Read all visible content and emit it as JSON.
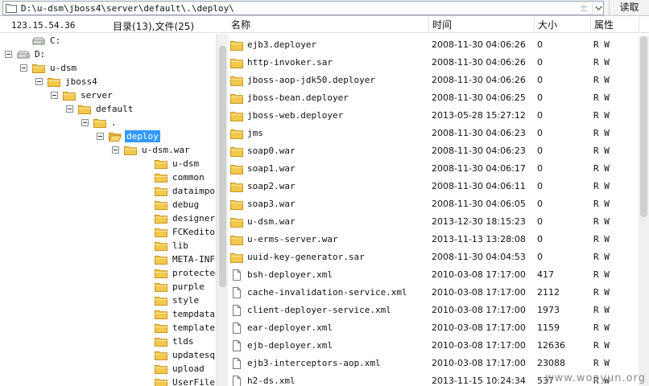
{
  "topbar": {
    "path": "D:\\u-dsm\\jboss4\\server\\default\\.\\deploy\\",
    "sort_glyph": "±",
    "read_label": "读取"
  },
  "left": {
    "server_ip": "123.15.54.36",
    "dir_count": "目录(13),文件(25)"
  },
  "tree": [
    {
      "label": "C:",
      "icon": "drive-icon",
      "expander": "none"
    },
    {
      "label": "D:",
      "icon": "drive-icon",
      "expander": "minus"
    },
    {
      "label": "u-dsm",
      "icon": "folder-icon",
      "expander": "minus"
    },
    {
      "label": "jboss4",
      "icon": "folder-icon",
      "expander": "minus"
    },
    {
      "label": "server",
      "icon": "folder-icon",
      "expander": "minus"
    },
    {
      "label": "default",
      "icon": "folder-icon",
      "expander": "minus"
    },
    {
      "label": ".",
      "icon": "folder-icon",
      "expander": "minus"
    },
    {
      "label": "deploy",
      "icon": "folder-open-icon",
      "expander": "minus",
      "selected": true
    },
    {
      "label": "u-dsm.war",
      "icon": "folder-icon",
      "expander": "minus"
    },
    {
      "label": "u-dsm",
      "icon": "folder-icon",
      "expander": "none"
    },
    {
      "label": "common",
      "icon": "folder-icon",
      "expander": "none"
    },
    {
      "label": "dataimportter",
      "icon": "folder-icon",
      "expander": "none"
    },
    {
      "label": "debug",
      "icon": "folder-icon",
      "expander": "none"
    },
    {
      "label": "designer",
      "icon": "folder-icon",
      "expander": "none"
    },
    {
      "label": "FCKeditor",
      "icon": "folder-icon",
      "expander": "none"
    },
    {
      "label": "lib",
      "icon": "folder-icon",
      "expander": "none"
    },
    {
      "label": "META-INF",
      "icon": "folder-icon",
      "expander": "none"
    },
    {
      "label": "protected",
      "icon": "folder-icon",
      "expander": "none"
    },
    {
      "label": "purple",
      "icon": "folder-icon",
      "expander": "none"
    },
    {
      "label": "style",
      "icon": "folder-icon",
      "expander": "none"
    },
    {
      "label": "tempdatafile",
      "icon": "folder-icon",
      "expander": "none"
    },
    {
      "label": "templates",
      "icon": "folder-icon",
      "expander": "none"
    },
    {
      "label": "tlds",
      "icon": "folder-icon",
      "expander": "none"
    },
    {
      "label": "updatesql",
      "icon": "folder-icon",
      "expander": "none"
    },
    {
      "label": "upload",
      "icon": "folder-icon",
      "expander": "none"
    },
    {
      "label": "UserFiles",
      "icon": "folder-icon",
      "expander": "none"
    }
  ],
  "list": {
    "columns": [
      "名称",
      "时间",
      "大小",
      "属性"
    ],
    "rows": [
      {
        "name": "ejb3.deployer",
        "time": "2008-11-30 04:06:26",
        "size": "0",
        "attr": "R W",
        "type": "folder"
      },
      {
        "name": "http-invoker.sar",
        "time": "2008-11-30 04:06:26",
        "size": "0",
        "attr": "R W",
        "type": "folder"
      },
      {
        "name": "jboss-aop-jdk50.deployer",
        "time": "2008-11-30 04:06:26",
        "size": "0",
        "attr": "R W",
        "type": "folder"
      },
      {
        "name": "jboss-bean.deployer",
        "time": "2008-11-30 04:06:25",
        "size": "0",
        "attr": "R W",
        "type": "folder"
      },
      {
        "name": "jboss-web.deployer",
        "time": "2013-05-28 15:27:12",
        "size": "0",
        "attr": "R W",
        "type": "folder"
      },
      {
        "name": "jms",
        "time": "2008-11-30 04:06:23",
        "size": "0",
        "attr": "R W",
        "type": "folder"
      },
      {
        "name": "soap0.war",
        "time": "2008-11-30 04:06:23",
        "size": "0",
        "attr": "R W",
        "type": "folder"
      },
      {
        "name": "soap1.war",
        "time": "2008-11-30 04:06:17",
        "size": "0",
        "attr": "R W",
        "type": "folder"
      },
      {
        "name": "soap2.war",
        "time": "2008-11-30 04:06:11",
        "size": "0",
        "attr": "R W",
        "type": "folder"
      },
      {
        "name": "soap3.war",
        "time": "2008-11-30 04:06:05",
        "size": "0",
        "attr": "R W",
        "type": "folder"
      },
      {
        "name": "u-dsm.war",
        "time": "2013-12-30 18:15:23",
        "size": "0",
        "attr": "R W",
        "type": "folder"
      },
      {
        "name": "u-erms-server.war",
        "time": "2013-11-13 13:28:08",
        "size": "0",
        "attr": "R W",
        "type": "folder"
      },
      {
        "name": "uuid-key-generator.sar",
        "time": "2008-11-30 04:04:53",
        "size": "0",
        "attr": "R W",
        "type": "folder"
      },
      {
        "name": "bsh-deployer.xml",
        "time": "2010-03-08 17:17:00",
        "size": "417",
        "attr": "R W",
        "type": "file"
      },
      {
        "name": "cache-invalidation-service.xml",
        "time": "2010-03-08 17:17:00",
        "size": "2112",
        "attr": "R W",
        "type": "file"
      },
      {
        "name": "client-deployer-service.xml",
        "time": "2010-03-08 17:17:00",
        "size": "1973",
        "attr": "R W",
        "type": "file"
      },
      {
        "name": "ear-deployer.xml",
        "time": "2010-03-08 17:17:00",
        "size": "1159",
        "attr": "R W",
        "type": "file"
      },
      {
        "name": "ejb-deployer.xml",
        "time": "2010-03-08 17:17:00",
        "size": "12636",
        "attr": "R W",
        "type": "file"
      },
      {
        "name": "ejb3-interceptors-aop.xml",
        "time": "2010-03-08 17:17:00",
        "size": "23088",
        "attr": "R W",
        "type": "file"
      },
      {
        "name": "h2-ds.xml",
        "time": "2013-11-15 10:24:34",
        "size": "537",
        "attr": "R W",
        "type": "file"
      }
    ]
  },
  "watermark": "www.wooyun.org",
  "colors": {
    "selection": "#3399ff",
    "folder": "#f2c94c",
    "folder_edge": "#c9941e"
  }
}
